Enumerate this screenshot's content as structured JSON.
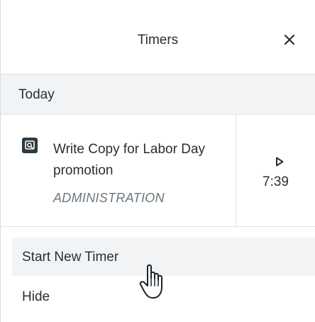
{
  "header": {
    "title": "Timers",
    "close_icon": "close-icon"
  },
  "section": {
    "label": "Today"
  },
  "timer": {
    "icon": "timer-task-icon",
    "title": "Write Copy for Labor Day promotion",
    "category": "ADMINISTRATION",
    "play_icon": "play-icon",
    "elapsed": "7:39"
  },
  "menu": {
    "start_label": "Start New Timer",
    "hide_label": "Hide"
  },
  "colors": {
    "hover_bg": "#f1f3f4",
    "divider": "#e1e5e8",
    "text": "#2a2f33",
    "muted": "#6b7880",
    "icon_bg": "#2f3a40"
  }
}
